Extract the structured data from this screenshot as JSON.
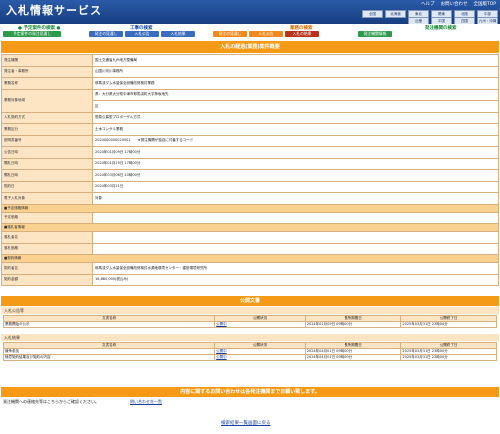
{
  "header": {
    "title": "入札情報サービス",
    "links": [
      "ヘルプ",
      "お問い合わせ",
      "全国版TOP"
    ],
    "regions": [
      "全国",
      "北海道",
      "東北",
      "関東",
      "北陸",
      "中部",
      "近畿",
      "中国",
      "四国",
      "九州・沖縄"
    ]
  },
  "nav": {
    "groups": [
      {
        "title": "● 予定案件の検索 ●",
        "color": "#1b8b3a"
      },
      {
        "title": "工事の検索",
        "color": "#1d4fa8"
      },
      {
        "title": "業務の検索",
        "color": "#e06a00"
      },
      {
        "title": "発注機関の検索",
        "color": "#1b8b3a"
      }
    ],
    "buttons": [
      "予定案件の発注見通し",
      "発注の見通し",
      "入札公告",
      "入札結果",
      "発注の見通し",
      "入札公告",
      "入札の結果",
      "発注機関情報"
    ]
  },
  "main_title": "入札の経過(業務)案件概要",
  "info_rows": [
    {
      "label": "発注機関",
      "value": "国土交通省九州地方整備局"
    },
    {
      "label": "発注者・事務所",
      "value": "山国川河川事務所"
    },
    {
      "label": "業務名称",
      "value": "耶馬渓ダム水量保全設備改修検討業務"
    },
    {
      "label": "業務対象地域",
      "value": "県：大分県大分県中津市耶馬渓町大字柿坂地先",
      "value2": "区"
    },
    {
      "label": "入札契約方式",
      "value": "簡易公募型プロポーザル方式"
    },
    {
      "label": "業務区分",
      "value": "土木コンサル業務"
    },
    {
      "label": "説明書番号",
      "value": "2024000000020001　　★発注機関が独自に付番するコード"
    },
    {
      "label": "公告日時",
      "value": "2024年01月09日 17時00分"
    },
    {
      "label": "開札日時",
      "value": "2024年01月25日 17時00分"
    },
    {
      "label": "開札日時",
      "value": "2024年03月06日 10時00分"
    },
    {
      "label": "契約日",
      "value": "2024年03月21日"
    },
    {
      "label": "電子入札対象",
      "value": "対象"
    }
  ],
  "sections": {
    "plan": "■予定価格情報",
    "plan_row": "予定価格",
    "award": "■落札者情報",
    "award_rows": [
      "落札者名",
      "落札価格"
    ],
    "contract": "■契約情報",
    "contract_rows": [
      {
        "label": "契約者名",
        "value": "耶馬渓ダム水量保全設備改修検討水源地環境センター・建設環境研究所"
      },
      {
        "label": "契約金額",
        "value": "16,885,000(税込み)"
      }
    ]
  },
  "public_docs_title": "公開文書",
  "notice": {
    "title": "入札公告等",
    "headers": [
      "文書名称",
      "公開状況",
      "長所期間日",
      "公開終了日"
    ],
    "rows": [
      [
        "業務開始の公示",
        "公開中",
        "2024年01月09日 09時00分",
        "2025年03月31日 23時00分"
      ]
    ]
  },
  "result": {
    "title": "入札結果",
    "headers": [
      "文書名称",
      "公開状況",
      "長所期間日",
      "公開終了日"
    ],
    "rows": [
      [
        "競争参加",
        "公開中",
        "2024年04月01日 09時00分",
        "2025年03月31日 23時00分"
      ],
      [
        "随意契約結果及び契約の内容",
        "公開中",
        "2024年04月01日 09時00分",
        "2025年03月31日 23時00分"
      ]
    ]
  },
  "contact_bar": "内容に関するお問い合わせは各発注機関までお願い致します。",
  "contact_text": "発注機関への連絡先等はこちらからご確認ください。",
  "contact_link": "問い合わせ先一覧",
  "back_link": "検索結果一覧画面に戻る"
}
